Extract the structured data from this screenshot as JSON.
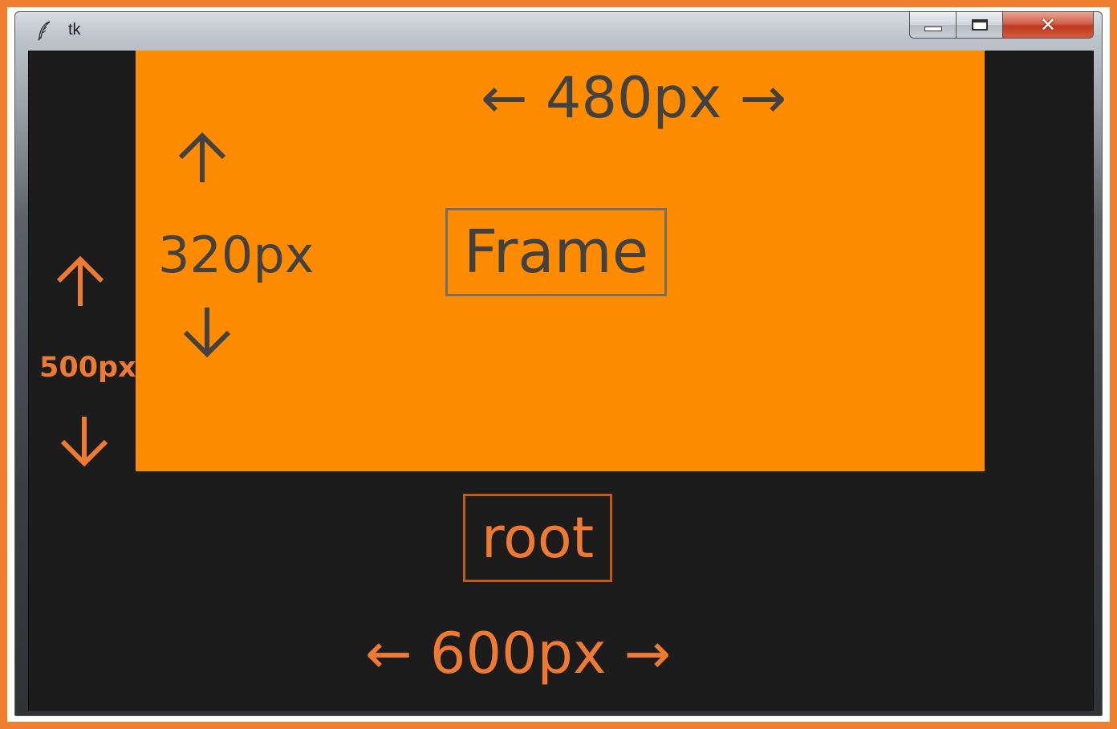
{
  "window": {
    "title": "tk",
    "icon": "tk-feather-icon",
    "controls": {
      "minimize": "minimize-icon",
      "maximize": "maximize-icon",
      "close_label": "✕"
    }
  },
  "frame": {
    "name": "Frame",
    "width_label": "← 480px →",
    "height_label": "320px",
    "color": "#ff8c00",
    "text_color": "#414141"
  },
  "root": {
    "name": "root",
    "width_label": "← 600px →",
    "height_label": "500px",
    "background": "#1c1c1c",
    "text_color": "#ee7a33"
  },
  "border_color": "#f07e2f"
}
